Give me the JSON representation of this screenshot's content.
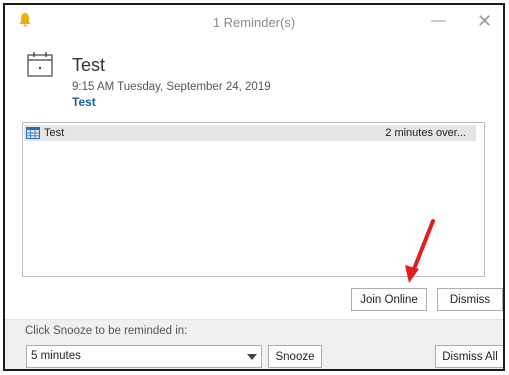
{
  "window": {
    "title": "1 Reminder(s)",
    "minimize_glyph": "—",
    "close_glyph": "✕"
  },
  "reminder": {
    "subject": "Test",
    "datetime": "9:15 AM Tuesday, September 24, 2019",
    "location": "Test"
  },
  "list": {
    "items": [
      {
        "subject": "Test",
        "due": "2 minutes over..."
      }
    ]
  },
  "buttons": {
    "join_online": "Join Online",
    "dismiss": "Dismiss",
    "snooze": "Snooze",
    "dismiss_all": "Dismiss All"
  },
  "snooze": {
    "label": "Click Snooze to be reminded in:",
    "selected": "5 minutes"
  },
  "colors": {
    "accent": "#1e5b9e",
    "bell": "#e8b000",
    "annotation_arrow": "#e02020",
    "list_selected": "#e5e5e5"
  },
  "icons": [
    "bell-icon",
    "calendar-icon",
    "calendar-grid-icon",
    "chevron-down-icon",
    "red-annotation-arrow"
  ]
}
